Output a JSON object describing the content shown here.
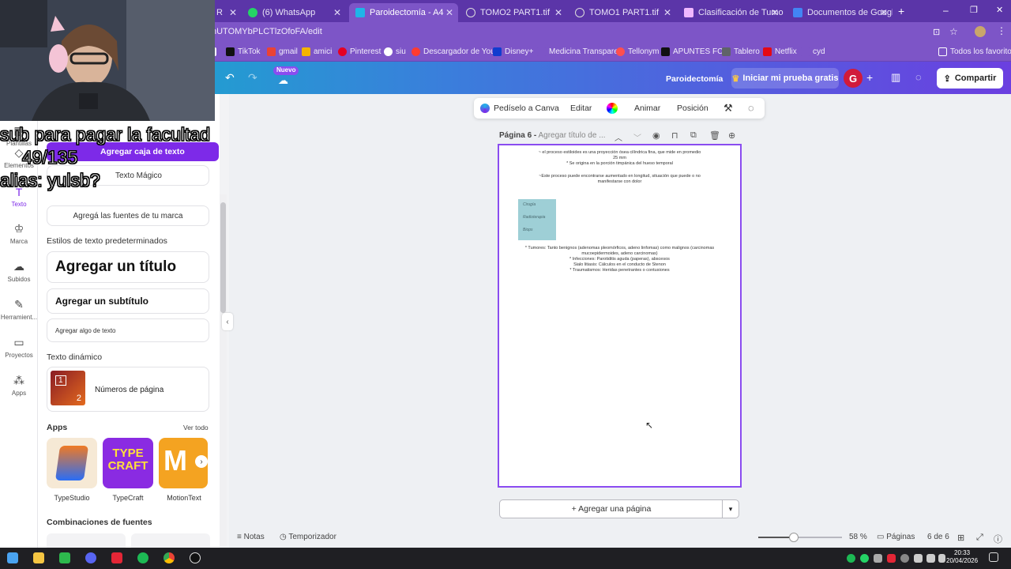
{
  "browser": {
    "tabs": [
      {
        "label": "R",
        "color": "#e8a43c"
      },
      {
        "label": "(6) WhatsApp",
        "color": "#25d366"
      },
      {
        "label": "Paroidectomía - A4",
        "color": "#1fb5e8",
        "active": true
      },
      {
        "label": "TOMO2 PART1.tif",
        "color": "#cccccc"
      },
      {
        "label": "TOMO1 PART1.tif",
        "color": "#cccccc"
      },
      {
        "label": "Clasificación de Tumores",
        "color": "#f0b8ff"
      },
      {
        "label": "Documentos de Google",
        "color": "#4285f4"
      }
    ],
    "new_tab": "+",
    "url": "nUTOMYbPLCTlzOfoFA/edit",
    "bookmarks": [
      {
        "label": "",
        "color": "#ffffff"
      },
      {
        "label": "TikTok",
        "color": "#111111"
      },
      {
        "label": "gmail",
        "color": "#ea4335"
      },
      {
        "label": "amici",
        "color": "#f4b400"
      },
      {
        "label": "Pinterest",
        "color": "#e60023"
      },
      {
        "label": "siu",
        "color": "#ffffff"
      },
      {
        "label": "Descargador de You...",
        "color": "#ff3b30"
      },
      {
        "label": "Disney+",
        "color": "#113ccf"
      },
      {
        "label": "Medicina Transpare...",
        "color": "#7d55c7"
      },
      {
        "label": "Tellonym",
        "color": "#ff4f4f"
      },
      {
        "label": "APUNTES FCM",
        "color": "#111111"
      },
      {
        "label": "Tablero",
        "color": "#5f6368"
      },
      {
        "label": "Netflix",
        "color": "#e50914"
      },
      {
        "label": "cyd",
        "color": "#7d55c7"
      }
    ],
    "all_favorites": "Todos los favoritos"
  },
  "overlay": {
    "line1": "sub para pagar la facultad",
    "line2": "49/135",
    "line3": "alias: yulsb?"
  },
  "canva_header": {
    "nuevo_badge": "Nuevo",
    "doc_title": "Paroidectomía",
    "trial_button": "Iniciar mi prueba gratis",
    "avatar_initial": "G",
    "share_button": "Compartir"
  },
  "rail": {
    "items": [
      {
        "label": "Plantillas",
        "icon": "▦"
      },
      {
        "label": "Elementos",
        "icon": "◇"
      },
      {
        "label": "Texto",
        "icon": "T"
      },
      {
        "label": "Marca",
        "icon": "♔"
      },
      {
        "label": "Subidos",
        "icon": "☁"
      },
      {
        "label": "Herramient...",
        "icon": "✎"
      },
      {
        "label": "Proyectos",
        "icon": "▭"
      },
      {
        "label": "Apps",
        "icon": "⁂"
      }
    ]
  },
  "text_panel": {
    "add_textbox": "Agregar caja de texto",
    "magic_text": "Texto Mágico",
    "brand_fonts": "Agregá las fuentes de tu marca",
    "default_styles_heading": "Estilos de texto predeterminados",
    "add_title": "Agregar un título",
    "add_subtitle": "Agregar un subtítulo",
    "add_body": "Agregar algo de texto",
    "dynamic_heading": "Texto dinámico",
    "page_numbers": "Números de página",
    "apps_heading": "Apps",
    "see_all": "Ver todo",
    "apps": [
      {
        "label": "TypeStudio",
        "color": "#2a6df5"
      },
      {
        "label": "TypeCraft",
        "color": "#8a2be2"
      },
      {
        "label": "MotionText",
        "color": "#f4a321"
      }
    ],
    "font_combos_heading": "Combinaciones de fuentes"
  },
  "context_toolbar": {
    "ask_canva": "Pedíselo a Canva",
    "edit": "Editar",
    "animate": "Animar",
    "position": "Posición"
  },
  "page": {
    "header_label": "Página 6 -",
    "header_placeholder": "Agregar título de ...",
    "lines": [
      "~ el proceso estiloides es una proyección ósea cilíndrica fina, que mide en promedio",
      "25 mm",
      "* Se origina en la porción timpánica del hueso temporal",
      "",
      "~Este proceso puede encontrarse aumentado en longitud, situación que puede o no",
      "manifestarse con dolor"
    ],
    "checklist": [
      "Cirugía",
      "Radioterapia",
      "Biops"
    ],
    "lines2": [
      "* Tumores: Tanto benignos (adenomas pleomórficos, adeno linfomas) como malignos (carcinomas",
      "mucoepidermoides, adeno carcinomas)",
      "* Infecciones: Parotiditis aguda (paperas), abscesos",
      "Sialo litiasis: Cálculos en el conducto de Stenon",
      "* Traumatismos: Heridas penetrantes o contusiones"
    ]
  },
  "add_page": "+ Agregar una página",
  "footer": {
    "notes": "Notas",
    "timer": "Temporizador",
    "zoom": "58 %",
    "zoom_level": 0.42,
    "pages": "Páginas",
    "page_count": "6 de 6"
  },
  "taskbar": {
    "time": "20:33",
    "date": "20/04/2026"
  }
}
